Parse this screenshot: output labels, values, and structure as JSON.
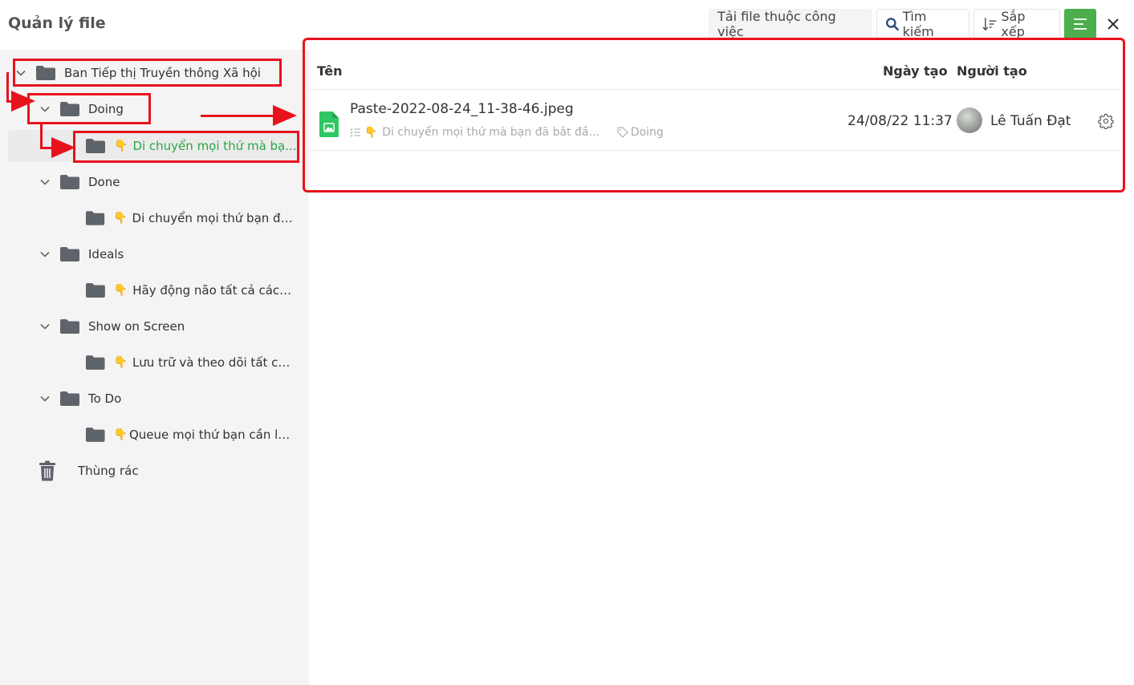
{
  "header": {
    "title": "Quản lý file",
    "download_button": "Tải file thuộc công việc",
    "search_button": "Tìm kiếm",
    "sort_button": "Sắp xếp",
    "accent_color": "#4cae4c"
  },
  "sidebar": {
    "root": {
      "label": "Ban Tiếp thị Truyền thông Xã hội",
      "expanded": true
    },
    "groups": [
      {
        "label": "Doing",
        "child": {
          "emoji": "👇",
          "label": "Di chuyển mọi thứ mà bạ...",
          "selected": true
        }
      },
      {
        "label": "Done",
        "child": {
          "emoji": "👇",
          "label": "Di chuyển mọi thứ bạn đã..."
        }
      },
      {
        "label": "Ideals",
        "child": {
          "emoji": "👇",
          "label": "Hãy động não tất cả các ..."
        }
      },
      {
        "label": "Show on Screen",
        "child": {
          "emoji": "👇",
          "label": "Lưu trữ và theo dõi tất cả..."
        }
      },
      {
        "label": "To Do",
        "child": {
          "emoji": "👇",
          "label": "Queue mọi thứ bạn cần là..."
        }
      }
    ],
    "trash": "Thùng rác",
    "selected_color": "#28a745"
  },
  "table": {
    "columns": {
      "name": "Tên",
      "created": "Ngày tạo",
      "creator": "Người tạo"
    },
    "rows": [
      {
        "file_name": "Paste-2022-08-24_11-38-46.jpeg",
        "task_emoji": "👇",
        "task": "Di chuyển mọi thứ mà bạn đã bắt đầ...",
        "tag": "Doing",
        "created": "24/08/22 11:37",
        "creator": "Lê Tuấn Đạt"
      }
    ]
  },
  "annotation_color": "#e8121d"
}
